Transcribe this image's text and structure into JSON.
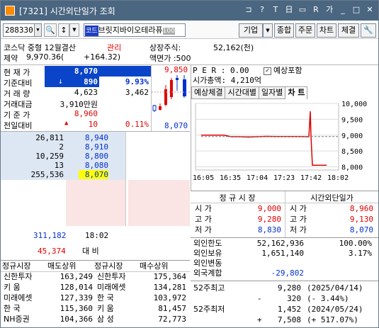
{
  "window": {
    "title": "[7321] 시간외단일가 조회",
    "controls": [
      "ꟷ",
      "?",
      "T",
      "日",
      "▬",
      "R",
      "가",
      "ꟷ",
      "□",
      "✕"
    ]
  },
  "toolbar": {
    "code": "288330",
    "name_tag": "코드",
    "name": "브릿지바이오테라퓨",
    "name_tail": "100",
    "buttons": [
      "기업",
      "종합",
      "주문",
      "차트",
      "체결"
    ],
    "tool_icon": "wrench-icon"
  },
  "info": {
    "market": "코스닥 중형 12월결산",
    "status": "관리",
    "listed_label": "상장주식:",
    "listed_value": "52,162(천)",
    "line2_label": "제약",
    "line2_price": "9,970.36(",
    "line2_change": "+164.32)",
    "par_label": "액면가 :500"
  },
  "price": {
    "rows": [
      {
        "k": "현 재 가",
        "v1": "8,070",
        "v2": ""
      },
      {
        "k": "기준대비",
        "v1": "890",
        "v2": "9.93%"
      },
      {
        "k": "거 래 량",
        "v1": "4,623",
        "v2": "3,462"
      },
      {
        "k": "거래대금",
        "v1": "3,910만원",
        "v2": ""
      },
      {
        "k": "기 준 가",
        "v1": "8,960",
        "v2": ""
      },
      {
        "k": "전일대비",
        "v1": "10",
        "v2": "0.11%"
      }
    ],
    "mini_high": "9,850",
    "mini_low": "8,070"
  },
  "right_top": {
    "per_label": "P E R : 0.00",
    "checkbox_label": "예상포함",
    "cap_label": "시가총액: 4,210억",
    "tabs": [
      "예상체결",
      "시간대별",
      "일자별",
      "차 트"
    ]
  },
  "chart_data": {
    "type": "line",
    "x": [
      "16:05",
      "16:35",
      "17:04",
      "17:23",
      "17:42",
      "18:02"
    ],
    "y_ticks": [
      "10,000",
      "9,500",
      "9,000",
      "8,500",
      "8,000"
    ],
    "ylim": [
      7900,
      10000
    ],
    "series": [
      {
        "values": [
          9000,
          9000,
          8950,
          8950,
          8940,
          8950,
          8960,
          8955,
          8955,
          8955,
          8950,
          9750,
          8960,
          8050,
          8050
        ]
      }
    ]
  },
  "orderbook": {
    "ask_qty": [
      "26,811",
      "2",
      "10,259",
      "13",
      "255,536"
    ],
    "ask_px": [
      "8,940",
      "8,910",
      "8,800",
      "8,080",
      "8,070"
    ],
    "total_ask": "311,182",
    "time": "18:02",
    "net": "45,374",
    "net_label": "대 비"
  },
  "session": {
    "reg_header": "정 규 시 장",
    "ext_header": "시간외단일가",
    "rows": [
      {
        "k": "시  가",
        "reg": "9,000",
        "k2": "시  가",
        "ext": "8,960"
      },
      {
        "k": "고  가",
        "reg": "9,280",
        "k2": "고  가",
        "ext": "9,130"
      },
      {
        "k": "저  가",
        "reg": "8,830",
        "k2": "저  가",
        "ext": "8,070"
      }
    ]
  },
  "foreign": {
    "rows": [
      {
        "k": "외인한도",
        "v1": "52,162,936",
        "v2": "100.00%"
      },
      {
        "k": "외인보유",
        "v1": "1,651,140",
        "v2": "3.17%"
      },
      {
        "k": "외인변동",
        "v1": "",
        "v2": ""
      },
      {
        "k": "외국계합",
        "v1": "-29,802",
        "v2": ""
      }
    ]
  },
  "w52": {
    "rows": [
      {
        "k": "52주최고",
        "sign": "",
        "v": "9,280",
        "d": "(2025/04/14)"
      },
      {
        "k": "",
        "sign": "-",
        "v": "320",
        "d": "(-     3.44%)"
      },
      {
        "k": "52주최저",
        "sign": "",
        "v": "1,452",
        "d": "(2024/05/24)"
      },
      {
        "k": "",
        "sign": "+",
        "v": "7,508",
        "d": "(+  517.07%)"
      }
    ]
  },
  "brokers": {
    "headers": [
      "정규시장",
      "매도상위",
      "정규시장",
      "매수상위"
    ],
    "rows": [
      {
        "s": "신한투자",
        "sv": "163,249",
        "b": "신한투자",
        "bv": "175,364"
      },
      {
        "s": "키    움",
        "sv": "128,014",
        "b": "미래에셋",
        "bv": "134,281"
      },
      {
        "s": "미래에셋",
        "sv": "127,339",
        "b": "한    국",
        "bv": "103,972"
      },
      {
        "s": "한    국",
        "sv": "115,360",
        "b": "키    움",
        "bv": "81,457"
      },
      {
        "s": "NH증권",
        "sv": "104,366",
        "b": "삼    성",
        "bv": "72,773"
      }
    ]
  }
}
